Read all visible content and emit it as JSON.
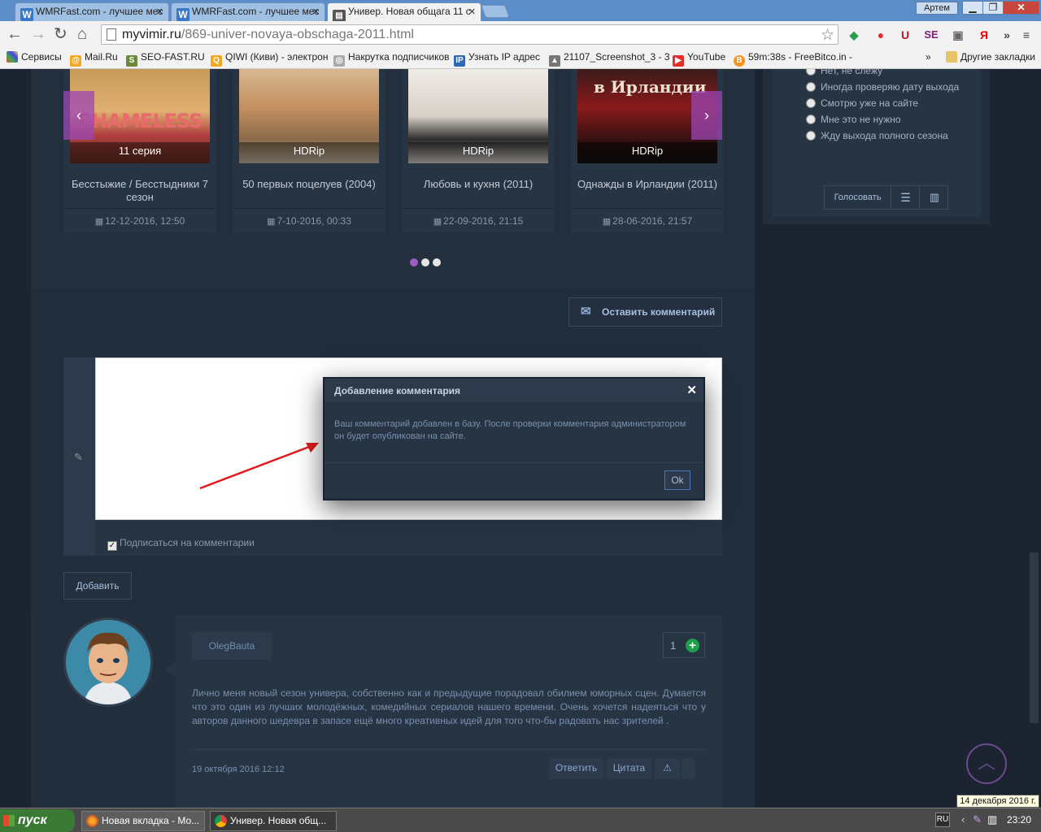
{
  "browser": {
    "tabs": [
      {
        "label": "WMRFast.com - лучшее мес"
      },
      {
        "label": "WMRFast.com - лучшее мес"
      },
      {
        "label": "Универ. Новая общага 11 с"
      }
    ],
    "user": "Артем",
    "url_host": "myvimir.ru",
    "url_path": "/869-univer-novaya-obschaga-2011.html",
    "bookmarks": [
      "Сервисы",
      "Mail.Ru",
      "SEO-FAST.RU",
      "QIWI (Киви) - электрон",
      "Накрутка подписчиков",
      "Узнать IP адрес",
      "21107_Screenshot_3 - 3",
      "YouTube",
      "59m:38s - FreeBitco.in -",
      "Другие закладки"
    ],
    "more_bookmarks": "»"
  },
  "carousel": {
    "items": [
      {
        "quality": "11 серия",
        "title": "Бесстыжие / Бесстыдники 7 сезон",
        "date": "12-12-2016, 12:50",
        "poster_text": "SHAMELESS"
      },
      {
        "quality": "HDRip",
        "title": "50 первых поцелуев (2004)",
        "date": "7-10-2016, 00:33"
      },
      {
        "quality": "HDRip",
        "title": "Любовь и кухня (2011)",
        "date": "22-09-2016, 21:15"
      },
      {
        "quality": "HDRip",
        "title": "Однажды в Ирландии (2011)",
        "date": "28-06-2016, 21:57",
        "poster_text": "в Ирландии"
      }
    ],
    "prev": "‹",
    "next": "›",
    "active_page": 1,
    "page_count": 3
  },
  "comment_form": {
    "leave_comment_label": "Оставить комментарий",
    "subscribe_label": "Подписаться на комментарии",
    "subscribe_checked": true,
    "submit_label": "Добавить"
  },
  "modal": {
    "title": "Добавление комментария",
    "message": "Ваш комментарий добавлен в базу. После проверки комментария администратором он будет опубликован на сайте.",
    "ok_label": "Ok"
  },
  "comment": {
    "author": "OlegBauta",
    "rating": "1",
    "text": "Лично меня новый сезон универа, собственно как и предыдущие порадовал обилием юморных сцен. Думается что это один из лучших молодёжных, комедийных сериалов нашего времени. Очень хочется надеяться что у авторов данного шедевра в запасе ещё много креативных идей для того что-бы радовать нас зрителей .",
    "date": "19 октября 2016 12:12",
    "reply_label": "Ответить",
    "quote_label": "Цитата"
  },
  "poll": {
    "options": [
      "Нет, не слежу",
      "Иногда проверяю дату выхода",
      "Смотрю уже на сайте",
      "Мне это не нужно",
      "Жду выхода полного сезона"
    ],
    "vote_label": "Голосовать"
  },
  "taskbar": {
    "start_label": "пуск",
    "tasks": [
      {
        "label": "Новая вкладка - Мо..."
      },
      {
        "label": "Универ. Новая общ..."
      }
    ],
    "lang": "RU",
    "time": "23:20",
    "date_tooltip": "14 декабря 2016 г."
  },
  "colors": {
    "page_bg": "#1b2430",
    "panel_bg": "#273444",
    "accent_purple": "#9b5cc4",
    "link_blue": "#a9c0dc",
    "plus_green": "#1ea04a"
  }
}
